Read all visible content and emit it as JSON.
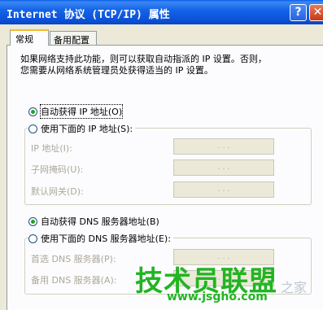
{
  "window": {
    "title": "Internet 协议 (TCP/IP) 属性",
    "help_glyph": "?",
    "close_glyph": "✕"
  },
  "tabs": [
    {
      "label": "常规",
      "selected": true
    },
    {
      "label": "备用配置",
      "selected": false
    }
  ],
  "description": "如果网络支持此功能，则可以获取自动指派的 IP 设置。否则，\n您需要从网络系统管理员处获得适当的 IP 设置。",
  "ip_section": {
    "auto_label": "自动获得 IP 地址(O)",
    "auto_checked": true,
    "manual_label": "使用下面的 IP 地址(S):",
    "manual_checked": false,
    "fields": [
      {
        "label": "IP 地址(I):",
        "value": ". . ."
      },
      {
        "label": "子网掩码(U):",
        "value": ". . ."
      },
      {
        "label": "默认网关(D):",
        "value": ". . ."
      }
    ]
  },
  "dns_section": {
    "auto_label": "自动获得 DNS 服务器地址(B)",
    "auto_checked": true,
    "manual_label": "使用下面的 DNS 服务器地址(E):",
    "manual_checked": false,
    "fields": [
      {
        "label": "首选 DNS 服务器(P):",
        "value": ". . ."
      },
      {
        "label": "备用 DNS 服务器(A):",
        "value": ". . ."
      }
    ]
  },
  "watermark": {
    "brand": "技术员联盟",
    "url": "www.jsgho.com",
    "home": "之家"
  },
  "colors": {
    "titlebar": "#0b4fd6",
    "dialog_bg": "#ece9d8",
    "radio_dot": "#21a121",
    "watermark": "#21b521",
    "disabled_text": "#aca899"
  }
}
